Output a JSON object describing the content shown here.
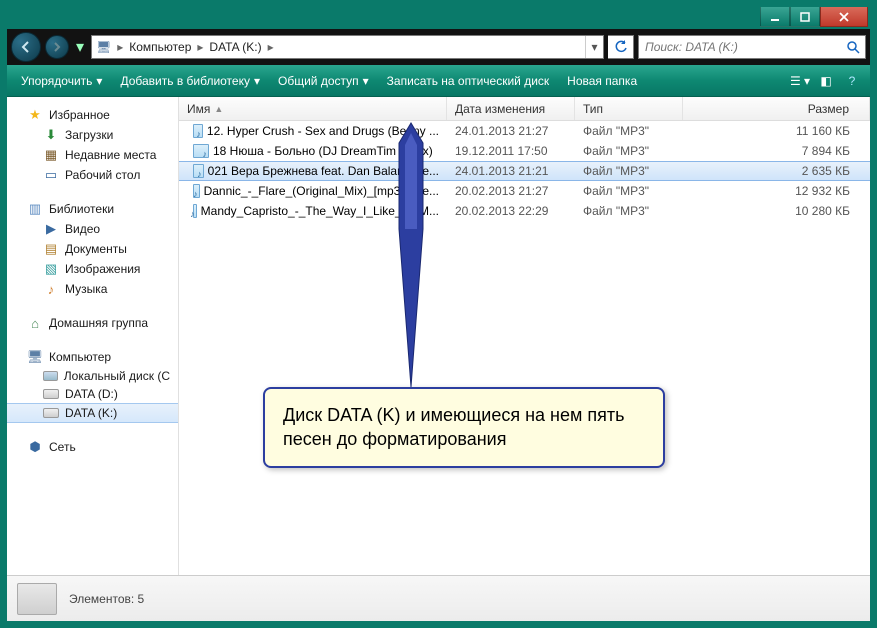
{
  "breadcrumb": {
    "seg1": "Компьютер",
    "seg2": "DATA (K:)"
  },
  "search": {
    "placeholder": "Поиск: DATA (K:)"
  },
  "toolbar": {
    "organize": "Упорядочить",
    "addlib": "Добавить в библиотеку",
    "share": "Общий доступ",
    "burn": "Записать на оптический диск",
    "newfolder": "Новая папка"
  },
  "sidebar": {
    "favorites": "Избранное",
    "downloads": "Загрузки",
    "recent": "Недавние места",
    "desktop": "Рабочий стол",
    "libraries": "Библиотеки",
    "video": "Видео",
    "documents": "Документы",
    "images": "Изображения",
    "music": "Музыка",
    "homegroup": "Домашняя группа",
    "computer": "Компьютер",
    "localdisk": "Локальный диск (C",
    "data_d": "DATA (D:)",
    "data_k": "DATA (K:)",
    "network": "Сеть"
  },
  "columns": {
    "name": "Имя",
    "date": "Дата изменения",
    "type": "Тип",
    "size": "Размер"
  },
  "files": [
    {
      "name": "12. Hyper Crush - Sex and Drugs (Benny ...",
      "date": "24.01.2013 21:27",
      "type": "Файл \"MP3\"",
      "size": "11 160 КБ",
      "selected": false
    },
    {
      "name": "18 Нюша - Больно (DJ DreamTim remix)",
      "date": "19.12.2011 17:50",
      "type": "Файл \"MP3\"",
      "size": "7 894 КБ",
      "selected": false
    },
    {
      "name": "021 Вера Брежнева feat. Dan Balan - Ле...",
      "date": "24.01.2013 21:21",
      "type": "Файл \"MP3\"",
      "size": "2 635 КБ",
      "selected": true
    },
    {
      "name": "Dannic_-_Flare_(Original_Mix)_[mp3pulse...",
      "date": "20.02.2013 21:27",
      "type": "Файл \"MP3\"",
      "size": "12 932 КБ",
      "selected": false
    },
    {
      "name": "Mandy_Capristo_-_The_Way_I_Like_It_(M...",
      "date": "20.02.2013 22:29",
      "type": "Файл \"MP3\"",
      "size": "10 280 КБ",
      "selected": false
    }
  ],
  "callout": {
    "text": "Диск DATA (K) и имеющиеся на нем пять песен до форматирования"
  },
  "status": {
    "label": "Элементов: 5"
  }
}
